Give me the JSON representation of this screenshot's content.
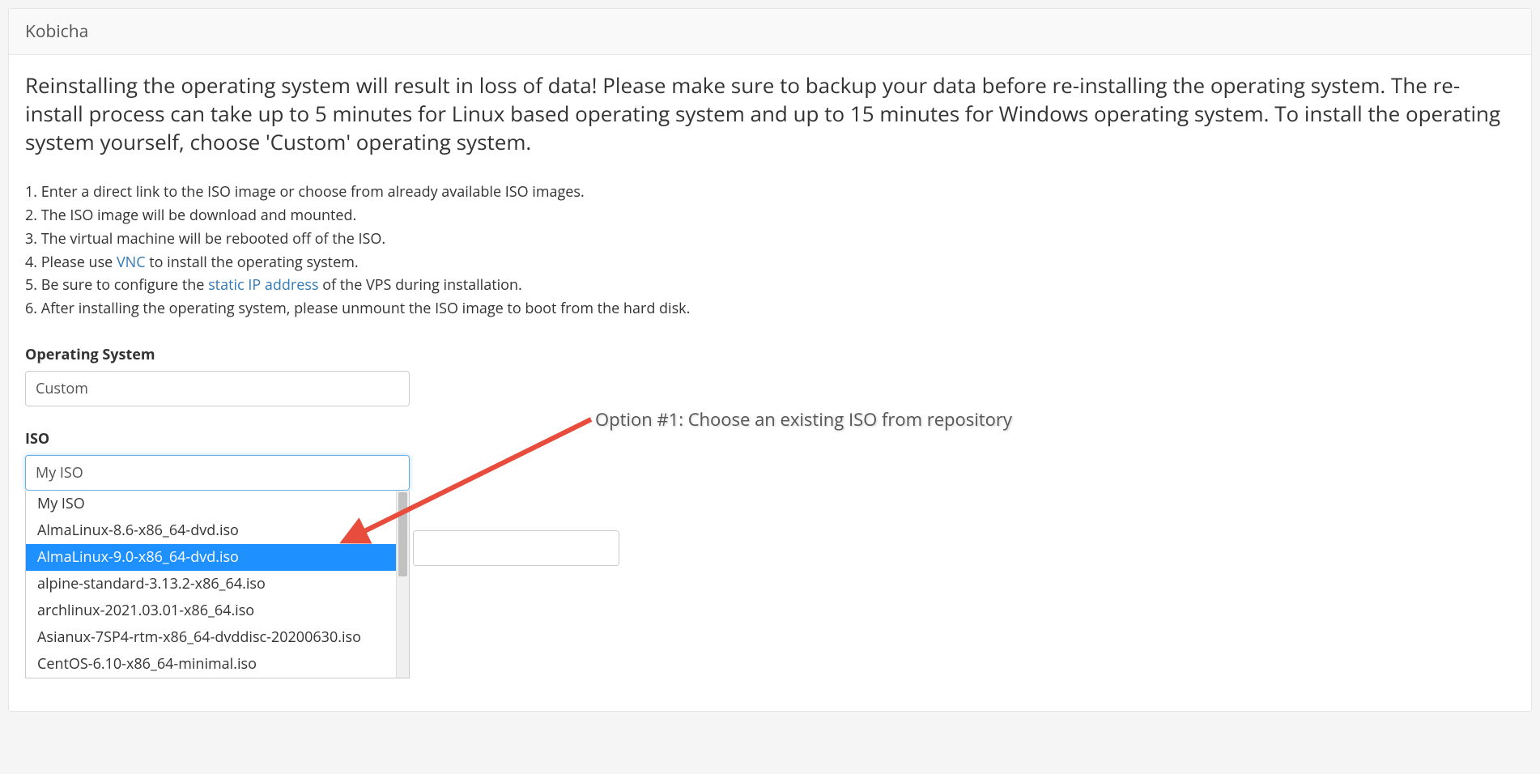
{
  "panel": {
    "title": "Kobicha"
  },
  "warning": "Reinstalling the operating system will result in loss of data! Please make sure to backup your data before re-installing the operating system. The re-install process can take up to 5 minutes for Linux based operating system and up to 15 minutes for Windows operating system. To install the operating system yourself, choose 'Custom' operating system.",
  "instructions": {
    "step1": "1. Enter a direct link to the ISO image or choose from already available ISO images.",
    "step2": "2. The ISO image will be download and mounted.",
    "step3": "3. The virtual machine will be rebooted off of the ISO.",
    "step4_pre": "4. Please use ",
    "step4_link": "VNC",
    "step4_post": " to install the operating system.",
    "step5_pre": "5. Be sure to configure the ",
    "step5_link": "static IP address",
    "step5_post": " of the VPS during installation.",
    "step6": "6. After installing the operating system, please unmount the ISO image to boot from the hard disk."
  },
  "form": {
    "os_label": "Operating System",
    "os_value": "Custom",
    "iso_label": "ISO",
    "iso_value": "My ISO",
    "iso_options": [
      "My ISO",
      "AlmaLinux-8.6-x86_64-dvd.iso",
      "AlmaLinux-9.0-x86_64-dvd.iso",
      "alpine-standard-3.13.2-x86_64.iso",
      "archlinux-2021.03.01-x86_64.iso",
      "Asianux-7SP4-rtm-x86_64-dvddisc-20200630.iso",
      "CentOS-6.10-x86_64-minimal.iso"
    ],
    "iso_highlighted_index": 2
  },
  "annotation": {
    "text": "Option #1: Choose an existing ISO from repository"
  },
  "colors": {
    "link": "#337ab7",
    "highlight": "#1e90ff",
    "arrow": "#e74c3c"
  }
}
